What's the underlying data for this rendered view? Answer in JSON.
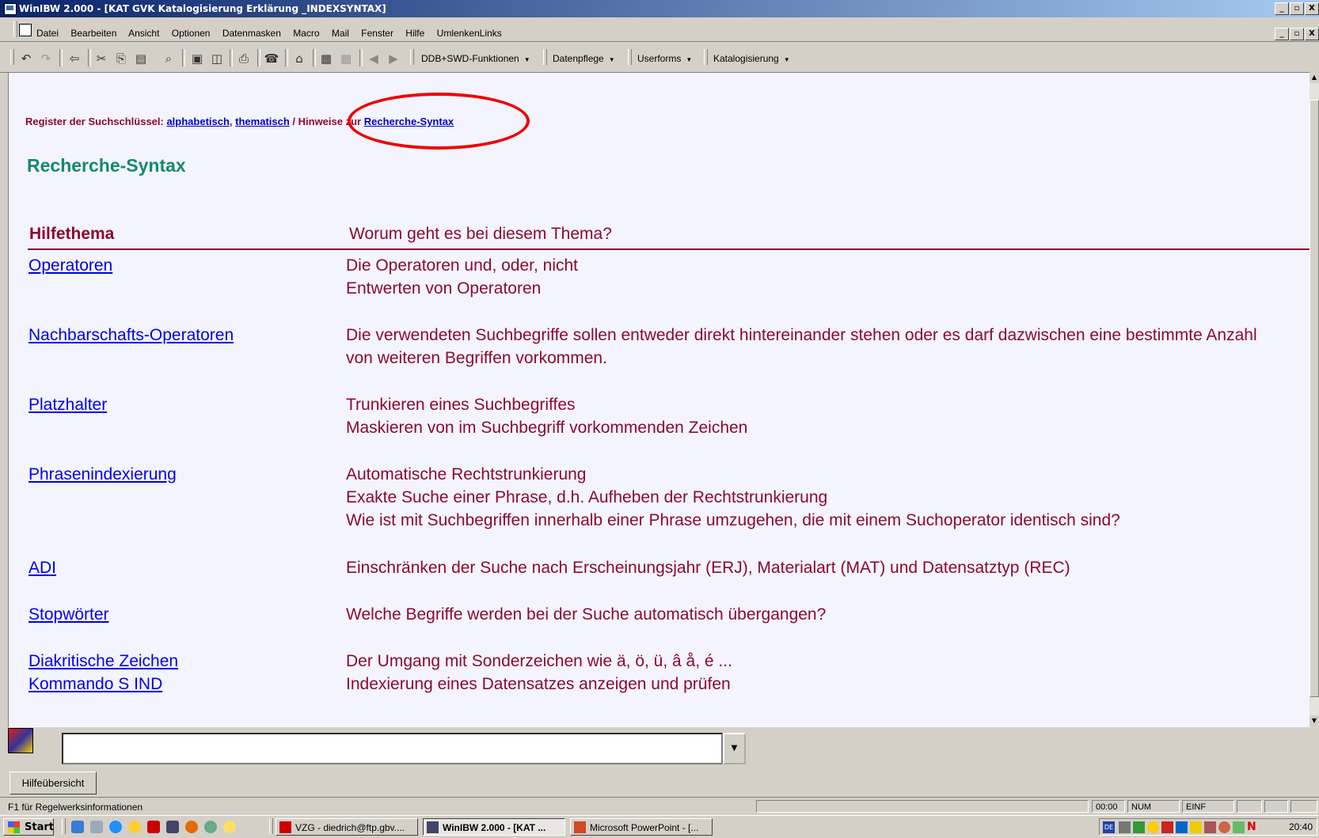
{
  "window": {
    "title": "WinIBW 2.000 - [KAT GVK Katalogisierung Erklärung _INDEXSYNTAX]",
    "controls": [
      "_",
      "▫",
      "X"
    ]
  },
  "menu": [
    "Datei",
    "Bearbeiten",
    "Ansicht",
    "Optionen",
    "Datenmasken",
    "Macro",
    "Mail",
    "Fenster",
    "Hilfe",
    "UmlenkenLinks"
  ],
  "toolbar": {
    "dropdowns": [
      "DDB+SWD-Funktionen",
      "Datenpflege",
      "Userforms",
      "Katalogisierung"
    ]
  },
  "content": {
    "breadcrumb": {
      "prefix": "Register der Suchschlüssel: ",
      "link_alpha": "alphabetisch",
      "comma": ", ",
      "link_thema": "thematisch",
      "middle": " / Hinweise zur ",
      "link_syntax": "Recherche-Syntax"
    },
    "title": "Recherche-Syntax",
    "header": {
      "topic": "Hilfethema",
      "description": "Worum geht es bei diesem Thema?"
    },
    "rows": [
      {
        "topic": "Operatoren",
        "lines": [
          "Die Operatoren und, oder, nicht",
          "Entwerten von Operatoren"
        ]
      },
      {
        "topic": "Nachbarschafts-Operatoren",
        "lines": [
          "Die verwendeten Suchbegriffe sollen entweder direkt hintereinander stehen oder es darf dazwischen eine bestimmte Anzahl",
          "von weiteren Begriffen vorkommen."
        ]
      },
      {
        "topic": "Platzhalter",
        "lines": [
          "Trunkieren eines Suchbegriffes",
          "Maskieren von im Suchbegriff vorkommenden Zeichen"
        ]
      },
      {
        "topic": "Phrasenindexierung",
        "lines": [
          "Automatische Rechtstrunkierung",
          "Exakte Suche einer Phrase, d.h. Aufheben der Rechtstrunkierung",
          "Wie ist mit Suchbegriffen innerhalb einer Phrase umzugehen, die mit einem Suchoperator identisch sind?"
        ]
      },
      {
        "topic": "ADI",
        "lines": [
          "Einschränken der Suche nach Erscheinungsjahr (ERJ), Materialart (MAT) und Datensatztyp (REC)"
        ]
      },
      {
        "topic": "Stopwörter",
        "lines": [
          "Welche Begriffe werden bei der Suche automatisch übergangen?"
        ]
      },
      {
        "topic": "Diakritische Zeichen",
        "lines": [
          "Der Umgang mit Sonderzeichen wie ä, ö, ü, â å, é ..."
        ]
      },
      {
        "topic": "Kommando S IND",
        "lines": [
          "Indexierung eines Datensatzes anzeigen und prüfen"
        ]
      }
    ]
  },
  "command": {
    "value": ""
  },
  "buttons": {
    "help_overview": "Hilfeübersicht"
  },
  "status": {
    "text": "F1 für Regelwerksinformationen",
    "time": "00:00",
    "num": "NUM",
    "einf": "EINF"
  },
  "taskbar": {
    "start": "Start",
    "tasks": [
      "VZG - diedrich@ftp.gbv....",
      "WinIBW 2.000 - [KAT ...",
      "Microsoft PowerPoint - [..."
    ],
    "clock": "20:40"
  },
  "colors": {
    "accent": "#8b0a2e",
    "title_teal": "#138a6c",
    "link": "#0000ee",
    "highlight_circle": "#ee0000"
  }
}
